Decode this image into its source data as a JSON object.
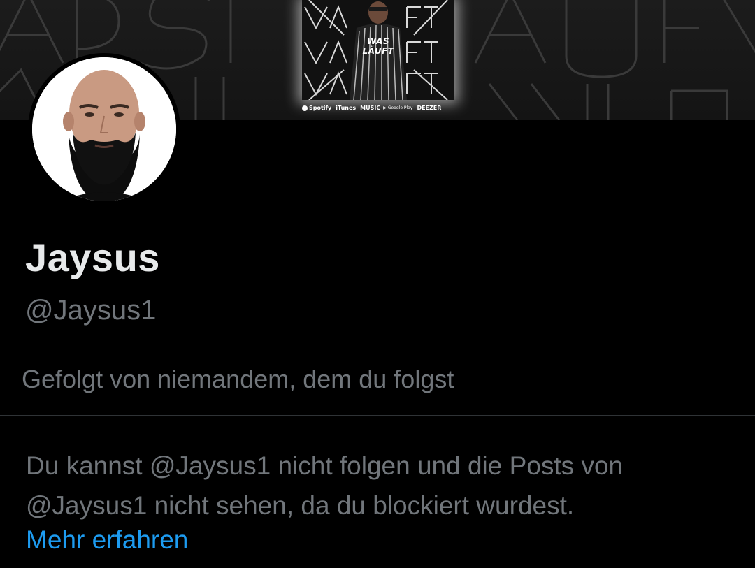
{
  "banner": {
    "cover_title": "WAS LÄUFT",
    "stores": [
      "Spotify",
      "iTunes",
      "MUSIC",
      "Google Play",
      "DEEZER"
    ]
  },
  "profile": {
    "display_name": "Jaysus",
    "handle": "@Jaysus1",
    "followed_by": "Gefolgt von niemandem, dem du folgst"
  },
  "blocked": {
    "message": "Du kannst @Jaysus1 nicht folgen und die Posts von @Jaysus1 nicht sehen, da du blockiert wurdest.",
    "learn_more": "Mehr erfahren"
  },
  "colors": {
    "background": "#000000",
    "primary_text": "#e7e9ea",
    "secondary_text": "#71767b",
    "link": "#1d9bf0",
    "divider": "#2f3336"
  }
}
